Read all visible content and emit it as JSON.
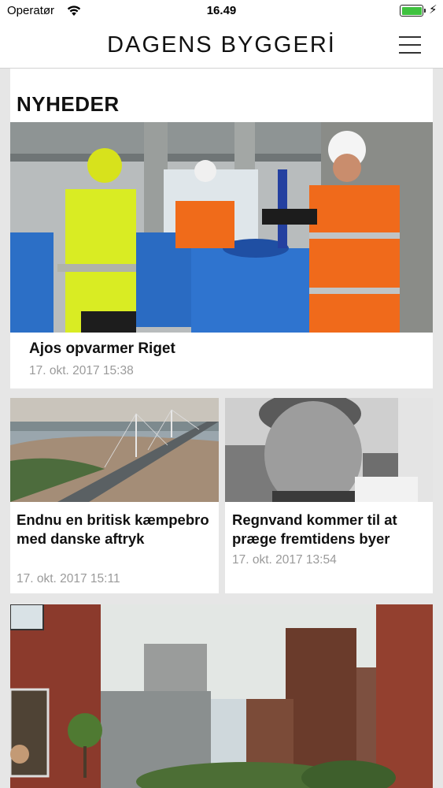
{
  "status_bar": {
    "carrier": "Operatør",
    "time": "16.49",
    "battery_level": 1.0,
    "charging_icon": "bolt-icon"
  },
  "header": {
    "logo_text": "DAGENS BYGGERİ",
    "menu_icon": "hamburger-menu-icon"
  },
  "section": {
    "title": "NYHEDER"
  },
  "articles": [
    {
      "title": "Ajos opvarmer Riget",
      "date": "17. okt. 2017 15:38"
    },
    {
      "title": "Endnu en britisk kæmpebro med danske aftryk",
      "date": "17. okt. 2017 15:11"
    },
    {
      "title": "Regnvand kommer til at præge fremtidens byer",
      "date": "17. okt. 2017 13:54"
    },
    {
      "title": "",
      "date": ""
    }
  ],
  "colors": {
    "background": "#e6e6e6",
    "card": "#ffffff",
    "date_text": "#9a9a9a",
    "battery_fill": "#3fc23f"
  }
}
